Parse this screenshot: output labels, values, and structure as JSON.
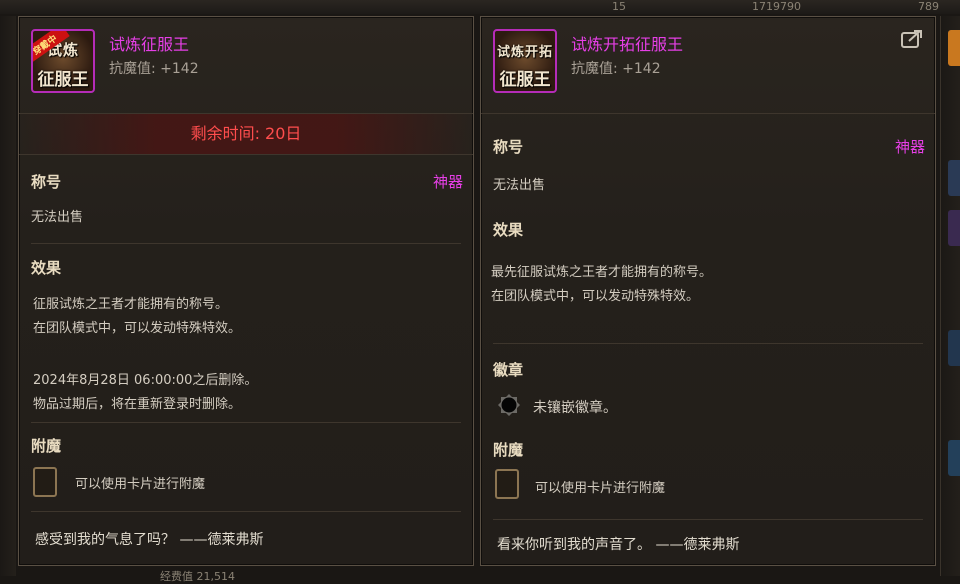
{
  "background": {
    "top_values": [
      "15",
      "1719790",
      "789"
    ],
    "bottom_text": "经费值 21,514"
  },
  "left": {
    "icon": {
      "line1": "试炼",
      "line2": "征服王",
      "badge": "穿戴中"
    },
    "title": "试炼征服王",
    "stat": "抗魔值: +142",
    "remaining": "剩余时间: 20日",
    "title_section": {
      "label": "称号",
      "rarity": "神器",
      "note": "无法出售"
    },
    "effect": {
      "label": "效果",
      "lines": [
        "征服试炼之王者才能拥有的称号。",
        "在团队模式中，可以发动特殊特效。"
      ],
      "expiry_lines": [
        "2024年8月28日 06:00:00之后删除。",
        "物品过期后，将在重新登录时删除。"
      ]
    },
    "enchant": {
      "label": "附魔",
      "slot_text": "可以使用卡片进行附魔"
    },
    "quote": "感受到我的气息了吗？ ——德莱弗斯"
  },
  "right": {
    "icon": {
      "line1": "试炼开拓",
      "line2": "征服王"
    },
    "title": "试炼开拓征服王",
    "stat": "抗魔值: +142",
    "title_section": {
      "label": "称号",
      "rarity": "神器",
      "note": "无法出售"
    },
    "effect": {
      "label": "效果",
      "lines": [
        "最先征服试炼之王者才能拥有的称号。",
        "在团队模式中，可以发动特殊特效。"
      ]
    },
    "emblem": {
      "label": "徽章",
      "slot_text": "未镶嵌徽章。"
    },
    "enchant": {
      "label": "附魔",
      "slot_text": "可以使用卡片进行附魔"
    },
    "quote": "看来你听到我的声音了。 ——德莱弗斯"
  },
  "colors": {
    "title_magenta": "#e63fe6",
    "remaining_red": "#ff4d4d",
    "border": "#5a5044"
  }
}
